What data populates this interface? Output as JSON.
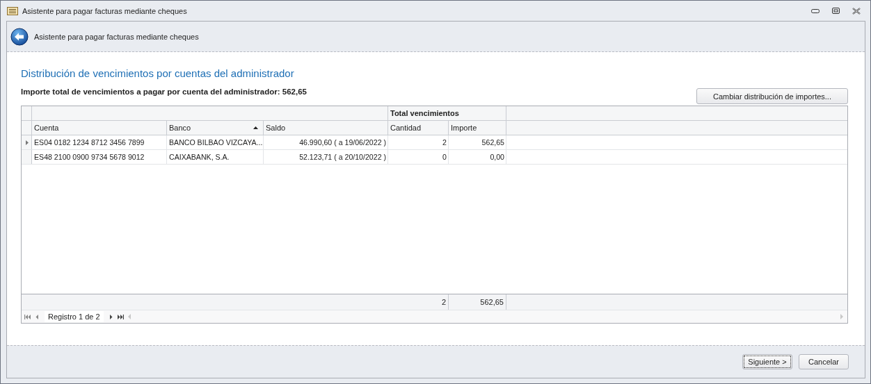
{
  "window": {
    "title": "Asistente para pagar facturas mediante cheques"
  },
  "header": {
    "title": "Asistente para pagar facturas mediante cheques"
  },
  "page_title": "Distribución de vencimientos por cuentas del administrador",
  "summary": {
    "label": "Importe total de vencimientos a pagar por cuenta del administrador:",
    "value": "562,65"
  },
  "change_button": "Cambiar distribución de importes...",
  "grid": {
    "band": "Total vencimientos",
    "columns": [
      {
        "label": "Cuenta",
        "sorted": false
      },
      {
        "label": "Banco",
        "sorted": true
      },
      {
        "label": "Saldo",
        "sorted": false
      },
      {
        "label": "Cantidad",
        "sorted": false
      },
      {
        "label": "Importe",
        "sorted": false
      }
    ],
    "rows": [
      {
        "focused": true,
        "cells": [
          "ES04 0182 1234 8712 3456 7899",
          "BANCO BILBAO VIZCAYA...",
          "46.990,60 ( a 19/06/2022 )",
          "2",
          "562,65"
        ]
      },
      {
        "focused": false,
        "cells": [
          "ES48 2100 0900 9734 5678 9012",
          "CAIXABANK, S.A.",
          "52.123,71 ( a 20/10/2022 )",
          "0",
          "0,00"
        ]
      }
    ],
    "totals": [
      "2",
      "562,65"
    ],
    "navigator": "Registro 1 de 2"
  },
  "buttons": [
    {
      "label": "Siguiente >",
      "focused": true
    },
    {
      "label": "Cancelar",
      "focused": false
    }
  ]
}
